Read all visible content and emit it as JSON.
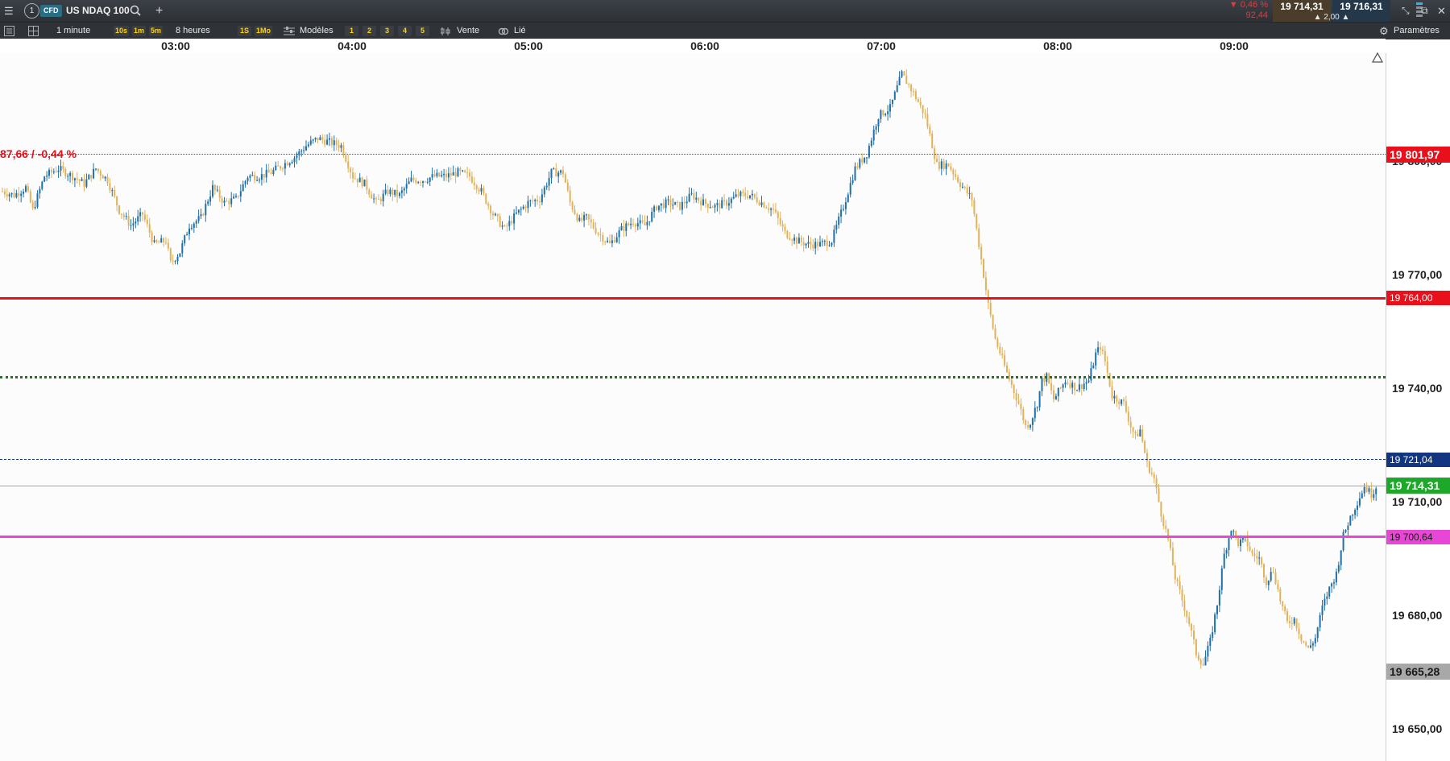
{
  "header": {
    "tab_number": "1",
    "cfd_badge": "CFD",
    "instrument": "US NDAQ 100",
    "change_pct": "▼ 0,46 %",
    "change_abs": "92,44",
    "bid": "19 714,31",
    "ask": "19 716,31",
    "spread": "▲ 2,00 ▲",
    "colors": {
      "down": "#e23b3b",
      "up": "#33c24a",
      "bid_bg": "#4a3d2a",
      "ask_bg": "#24384a"
    }
  },
  "toolbar": {
    "interval": "1 minute",
    "quick_intervals": [
      "10s",
      "1m",
      "5m"
    ],
    "range": "8 heures",
    "quick_ranges": [
      "1S",
      "1Mo"
    ],
    "models_label": "Modèles",
    "model_slots": [
      "1",
      "2",
      "3",
      "4",
      "5"
    ],
    "sell_label": "Vente",
    "linked_label": "Lié",
    "settings_label": "Paramètres"
  },
  "time_axis": [
    "03:00",
    "04:00",
    "05:00",
    "06:00",
    "07:00",
    "08:00",
    "09:00"
  ],
  "price_axis": [
    "19 800,00",
    "19 770,00",
    "19 740,00",
    "19 710,00",
    "19 680,00",
    "19 650,00"
  ],
  "chart_data": {
    "type": "candlestick",
    "ylim": [
      19645,
      19832
    ],
    "up_color": "#1f6fa8",
    "down_color": "#e2b25a",
    "x_range": [
      "02:10",
      "09:48"
    ],
    "close_path": [
      [
        0,
        19792
      ],
      [
        5,
        19791
      ],
      [
        10,
        19793
      ],
      [
        13,
        19787
      ],
      [
        18,
        19796
      ],
      [
        24,
        19798
      ],
      [
        30,
        19796
      ],
      [
        35,
        19794
      ],
      [
        40,
        19798
      ],
      [
        45,
        19795
      ],
      [
        50,
        19787
      ],
      [
        55,
        19783
      ],
      [
        60,
        19786
      ],
      [
        65,
        19778
      ],
      [
        70,
        19779
      ],
      [
        72,
        19773
      ],
      [
        76,
        19776
      ],
      [
        80,
        19783
      ],
      [
        85,
        19785
      ],
      [
        90,
        19793
      ],
      [
        95,
        19789
      ],
      [
        100,
        19790
      ],
      [
        105,
        19796
      ],
      [
        110,
        19796
      ],
      [
        115,
        19797
      ],
      [
        120,
        19799
      ],
      [
        125,
        19801
      ],
      [
        130,
        19804
      ],
      [
        135,
        19806
      ],
      [
        140,
        19805
      ],
      [
        145,
        19804
      ],
      [
        150,
        19796
      ],
      [
        155,
        19794
      ],
      [
        160,
        19789
      ],
      [
        165,
        19792
      ],
      [
        170,
        19791
      ],
      [
        175,
        19795
      ],
      [
        180,
        19795
      ],
      [
        185,
        19796
      ],
      [
        190,
        19796
      ],
      [
        195,
        19797
      ],
      [
        200,
        19796
      ],
      [
        205,
        19792
      ],
      [
        210,
        19786
      ],
      [
        215,
        19782
      ],
      [
        220,
        19786
      ],
      [
        225,
        19789
      ],
      [
        230,
        19790
      ],
      [
        235,
        19797
      ],
      [
        240,
        19797
      ],
      [
        243,
        19789
      ],
      [
        247,
        19784
      ],
      [
        250,
        19785
      ],
      [
        255,
        19781
      ],
      [
        260,
        19778
      ],
      [
        265,
        19782
      ],
      [
        270,
        19784
      ],
      [
        275,
        19783
      ],
      [
        280,
        19788
      ],
      [
        285,
        19789
      ],
      [
        290,
        19788
      ],
      [
        295,
        19791
      ],
      [
        300,
        19789
      ],
      [
        305,
        19788
      ],
      [
        310,
        19789
      ],
      [
        315,
        19791
      ],
      [
        320,
        19791
      ],
      [
        325,
        19789
      ],
      [
        330,
        19787
      ],
      [
        335,
        19781
      ],
      [
        340,
        19779
      ],
      [
        345,
        19778
      ],
      [
        350,
        19778
      ],
      [
        355,
        19779
      ],
      [
        360,
        19788
      ],
      [
        365,
        19798
      ],
      [
        370,
        19802
      ],
      [
        375,
        19812
      ],
      [
        380,
        19814
      ],
      [
        385,
        19823
      ],
      [
        390,
        19818
      ],
      [
        395,
        19812
      ],
      [
        400,
        19799
      ],
      [
        405,
        19799
      ],
      [
        410,
        19794
      ],
      [
        415,
        19790
      ],
      [
        418,
        19778
      ],
      [
        420,
        19770
      ],
      [
        422,
        19762
      ],
      [
        425,
        19753
      ],
      [
        430,
        19744
      ],
      [
        435,
        19736
      ],
      [
        438,
        19730
      ],
      [
        440,
        19731
      ],
      [
        443,
        19736
      ],
      [
        445,
        19742
      ],
      [
        447,
        19743
      ],
      [
        450,
        19737
      ],
      [
        455,
        19742
      ],
      [
        460,
        19740
      ],
      [
        465,
        19742
      ],
      [
        468,
        19749
      ],
      [
        470,
        19751
      ],
      [
        472,
        19747
      ],
      [
        475,
        19738
      ],
      [
        480,
        19736
      ],
      [
        483,
        19730
      ],
      [
        485,
        19727
      ],
      [
        487,
        19729
      ],
      [
        490,
        19720
      ],
      [
        493,
        19716
      ],
      [
        496,
        19707
      ],
      [
        499,
        19700
      ],
      [
        502,
        19690
      ],
      [
        505,
        19684
      ],
      [
        508,
        19678
      ],
      [
        511,
        19670
      ],
      [
        514,
        19667
      ],
      [
        517,
        19673
      ],
      [
        520,
        19683
      ],
      [
        523,
        19696
      ],
      [
        526,
        19703
      ],
      [
        529,
        19699
      ],
      [
        532,
        19700
      ],
      [
        535,
        19696
      ],
      [
        538,
        19695
      ],
      [
        541,
        19689
      ],
      [
        544,
        19692
      ],
      [
        547,
        19684
      ],
      [
        550,
        19678
      ],
      [
        553,
        19679
      ],
      [
        556,
        19674
      ],
      [
        559,
        19671
      ],
      [
        562,
        19674
      ],
      [
        565,
        19682
      ],
      [
        568,
        19687
      ],
      [
        571,
        19691
      ],
      [
        574,
        19701
      ],
      [
        577,
        19706
      ],
      [
        580,
        19710
      ],
      [
        583,
        19714
      ],
      [
        586,
        19712
      ],
      [
        588,
        19714
      ]
    ]
  },
  "levels": [
    {
      "label": "19 801,97",
      "price": 19801.97,
      "color": "#e8101a",
      "style": "dotted-thin",
      "badge": "solid"
    },
    {
      "label": "19 764,00",
      "price": 19764.0,
      "color": "#e8101a",
      "style": "solid-thick",
      "badge": "solid"
    },
    {
      "label": "",
      "price": 19743.0,
      "color": "#1a7a1a",
      "style": "dotted-thick",
      "badge": "none"
    },
    {
      "label": "19 721,04",
      "price": 19721.04,
      "color": "#12357f",
      "style": "dashed",
      "badge": "solid"
    },
    {
      "label": "19 714,31",
      "price": 19714.31,
      "color": "#f08a6a",
      "style": "solid-thin",
      "badge": "green"
    },
    {
      "label": "19 700,64",
      "price": 19700.64,
      "color": "#e847d6",
      "style": "solid-thick",
      "badge": "solid"
    },
    {
      "label": "19 665,28",
      "price": 19665.28,
      "color": "#9a9a9a",
      "style": "none",
      "badge": "grey"
    }
  ],
  "overlay_text": "87,66 / -0,44 %",
  "colors": {
    "current_badge": "#1ea82a",
    "grey_badge": "#a8a8a8"
  }
}
